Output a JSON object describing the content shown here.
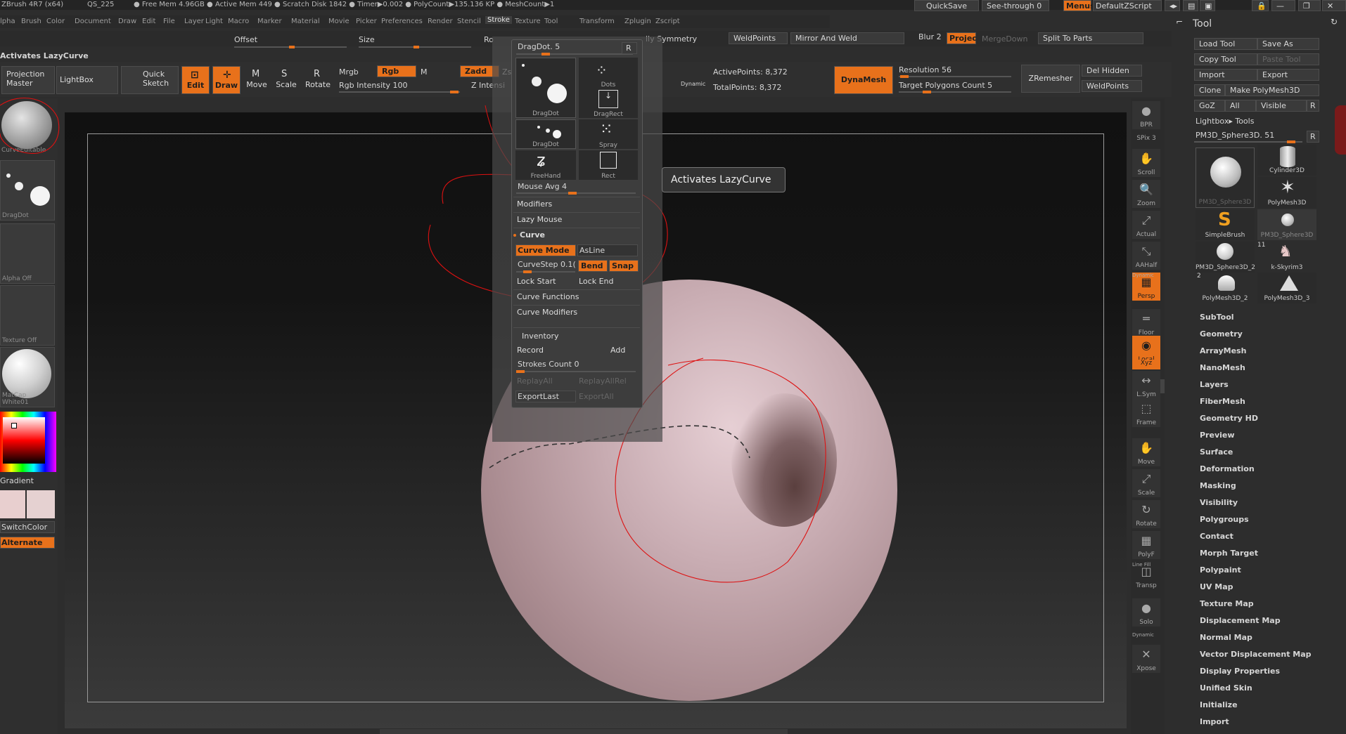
{
  "title_bar": {
    "app": "ZBrush 4R7 (x64)",
    "doc": "QS_225",
    "free_mem": "● Free Mem 4.96GB ● Active Mem 449 ● Scratch Disk 1842 ● Timer▶0.002 ● PolyCount▶135.136 KP ● MeshCount▶1",
    "quicksave": "QuickSave",
    "see_through": "See-through  0",
    "menus": "Menus",
    "script": "DefaultZScript"
  },
  "menu": [
    "lpha",
    "Brush",
    "Color",
    "Document",
    "Draw",
    "Edit",
    "File",
    "Layer",
    "Light",
    "Macro",
    "Marker",
    "Material",
    "Movie",
    "Picker",
    "Preferences",
    "Render",
    "Stencil",
    "Stroke",
    "Texture",
    "Tool",
    "Transform",
    "Zplugin",
    "Zscript"
  ],
  "shelf": {
    "offset": "Offset",
    "size": "Size",
    "rotate_partial": "Ro",
    "symmetry_partial": "lly Symmetry",
    "weld_points": "WeldPoints",
    "mirror_weld": "Mirror And Weld",
    "blur": "Blur 2",
    "project": "Projec",
    "merge_down": "MergeDown",
    "split_parts": "Split To Parts",
    "status": "Activates LazyCurve",
    "projection_master": "Projection Master",
    "lightbox": "LightBox",
    "quick_sketch": "Quick Sketch",
    "edit": "Edit",
    "draw": "Draw",
    "move": "Move",
    "scale": "Scale",
    "rotate": "Rotate",
    "mrgb": "Mrgb",
    "rgb": "Rgb",
    "m": "M",
    "zadd": "Zadd",
    "zsub_partial": "Zs",
    "rgb_intensity": "Rgb Intensity 100",
    "z_intensity_partial": "Z Intensi",
    "active_points": "ActivePoints: 8,372",
    "total_points": "TotalPoints: 8,372",
    "dynamic": "Dynamic",
    "dynamesh": "DynaMesh",
    "resolution": "Resolution 56",
    "target_polygons": "Target Polygons Count 5",
    "zremesher": "ZRemesher",
    "del_hidden": "Del Hidden",
    "weldpoints2": "WeldPoints"
  },
  "left_panel": {
    "brush_label": "CurveEditable",
    "stroke_label": "DragDot",
    "alpha_label": "Alpha  Off",
    "texture_label": "Texture  Off",
    "material_label": "MatCap  White01",
    "gradient": "Gradient",
    "switch_color": "SwitchColor",
    "alternate": "Alternate"
  },
  "stroke_popup": {
    "title": "DragDot. 5",
    "r": "R",
    "brushes": [
      {
        "label": "DragDot"
      },
      {
        "label": "Dots"
      },
      {
        "label": "DragRect"
      },
      {
        "label": "DragDot"
      },
      {
        "label": "Spray"
      },
      {
        "label": "FreeHand"
      },
      {
        "label": "Rect"
      }
    ],
    "mouse_avg": "Mouse Avg 4",
    "modifiers": "Modifiers",
    "lazy_mouse": "Lazy Mouse",
    "curve": "Curve",
    "curve_mode": "Curve Mode",
    "asline": "AsLine",
    "curvestep": "CurveStep 0.1(",
    "bend": "Bend",
    "snap": "Snap",
    "lock_start": "Lock Start",
    "lock_end": "Lock End",
    "curve_functions": "Curve Functions",
    "curve_modifiers": "Curve Modifiers",
    "inventory": "Inventory",
    "record": "Record",
    "add": "Add",
    "strokes_count": "Strokes Count 0",
    "replay_all": "ReplayAll",
    "replay_all_rel": "ReplayAllRel",
    "export_last": "ExportLast",
    "export_all": "ExportAll"
  },
  "tooltip": "Activates LazyCurve",
  "right_nav": [
    {
      "label": "BPR"
    },
    {
      "label": "SPix 3"
    },
    {
      "label": "Scroll"
    },
    {
      "label": "Zoom"
    },
    {
      "label": "Actual"
    },
    {
      "label": "AAHalf"
    },
    {
      "label": "Persp"
    },
    {
      "label": "Floor"
    },
    {
      "label": "Local"
    },
    {
      "label": "L.Sym"
    },
    {
      "label": "Frame"
    },
    {
      "label": "Move"
    },
    {
      "label": "Scale"
    },
    {
      "label": "Rotate"
    },
    {
      "label": "PolyF"
    },
    {
      "label": "Transp"
    },
    {
      "label": "Solo"
    },
    {
      "label": "Xpose"
    }
  ],
  "right_nav_extra": {
    "dynamic": "Dynamic",
    "xyz": "Xyz",
    "line_fill": "Line Fill",
    "dynamic2": "Dynamic"
  },
  "tool_panel": {
    "title": "Tool",
    "load_tool": "Load Tool",
    "save_as": "Save As",
    "copy_tool": "Copy Tool",
    "paste_tool": "Paste Tool",
    "import": "Import",
    "export": "Export",
    "clone": "Clone",
    "make_polymesh": "Make PolyMesh3D",
    "goz": "GoZ",
    "all": "All",
    "visible": "Visible",
    "r": "R",
    "lightbox_tools": "Lightbox▸ Tools",
    "current_tool": "PM3D_Sphere3D. 51",
    "thumbs": [
      {
        "label": "PM3D_Sphere3D"
      },
      {
        "label": "Cylinder3D"
      },
      {
        "label": "PolyMesh3D"
      },
      {
        "label": "SimpleBrush"
      },
      {
        "label": "PM3D_Sphere3D"
      },
      {
        "label": "PM3D_Sphere3D_2"
      },
      {
        "label": "k-Skyrim3"
      },
      {
        "label": "PolyMesh3D_2"
      },
      {
        "label": "PolyMesh3D_3"
      }
    ],
    "badge_11": "11",
    "badge_2": "2",
    "items": [
      "SubTool",
      "Geometry",
      "ArrayMesh",
      "NanoMesh",
      "Layers",
      "FiberMesh",
      "Geometry HD",
      "Preview",
      "Surface",
      "Deformation",
      "Masking",
      "Visibility",
      "Polygroups",
      "Contact",
      "Morph Target",
      "Polypaint",
      "UV Map",
      "Texture Map",
      "Displacement Map",
      "Normal Map",
      "Vector Displacement Map",
      "Display Properties",
      "Unified Skin",
      "Initialize",
      "Import"
    ]
  }
}
